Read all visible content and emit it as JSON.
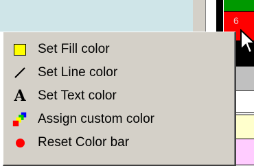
{
  "background": {
    "cell_label": "6",
    "cell_colors": [
      "#009900",
      "#ff0000",
      "#000000",
      "#ffffff",
      "#c0c0c0",
      "#ffffff",
      "#ffffff",
      "#ffffcc",
      "#ffccff"
    ]
  },
  "menu": {
    "items": [
      {
        "label": "Set Fill color",
        "icon": "fill-square-icon"
      },
      {
        "label": "Set Line color",
        "icon": "line-icon"
      },
      {
        "label": "Set Text color",
        "icon": "text-a-icon",
        "icon_text": "A"
      },
      {
        "label": "Assign custom color",
        "icon": "custom-color-squares-icon"
      },
      {
        "label": "Reset Color bar",
        "icon": "reset-octagon-icon"
      }
    ]
  },
  "colors": {
    "menu_bg": "#d4d0c8",
    "fill_icon": "#ffff00",
    "reset_icon": "#ff0000"
  }
}
